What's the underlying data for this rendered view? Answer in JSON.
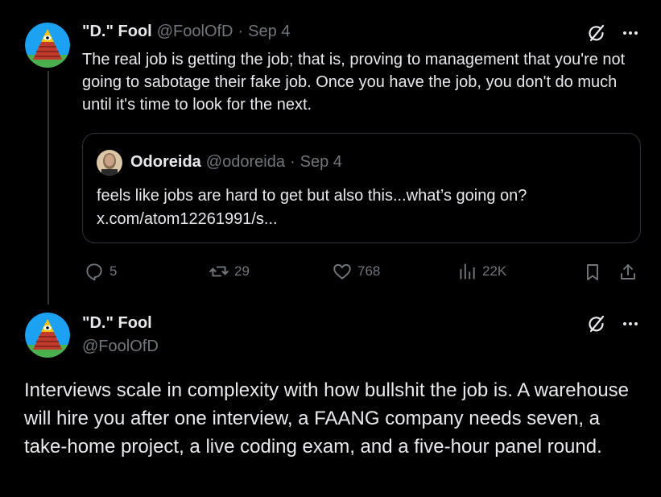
{
  "tweet1": {
    "display_name": "\"D.\" Fool",
    "handle": "@FoolOfD",
    "separator": "·",
    "date": "Sep 4",
    "text": "The real job is getting the job; that is, proving to management that you're not going to sabotage their fake job. Once you have the job, you don't do much until it's time to look for the next.",
    "quote": {
      "display_name": "Odoreida",
      "handle": "@odoreida",
      "separator": "·",
      "date": "Sep 4",
      "text_line1": "feels like jobs are hard to get but also this...what’s going on?",
      "link": "x.com/atom12261991/s..."
    },
    "actions": {
      "replies": "5",
      "reposts": "29",
      "likes": "768",
      "views": "22K"
    }
  },
  "tweet2": {
    "display_name": "\"D.\" Fool",
    "handle": "@FoolOfD",
    "text": "Interviews scale in complexity with how bullshit the job is. A warehouse will hire you after one interview, a FAANG company needs seven, a take-home project, a live coding exam, and a five-hour panel round."
  },
  "icons": {
    "grok": "grok-icon",
    "more": "more-icon",
    "reply": "reply-icon",
    "repost": "repost-icon",
    "like": "heart-icon",
    "views": "views-icon",
    "bookmark": "bookmark-icon",
    "share": "share-icon"
  },
  "colors": {
    "background": "#000000",
    "primary_text": "#e7e9ea",
    "secondary_text": "#71767b",
    "border": "#2f3336"
  }
}
